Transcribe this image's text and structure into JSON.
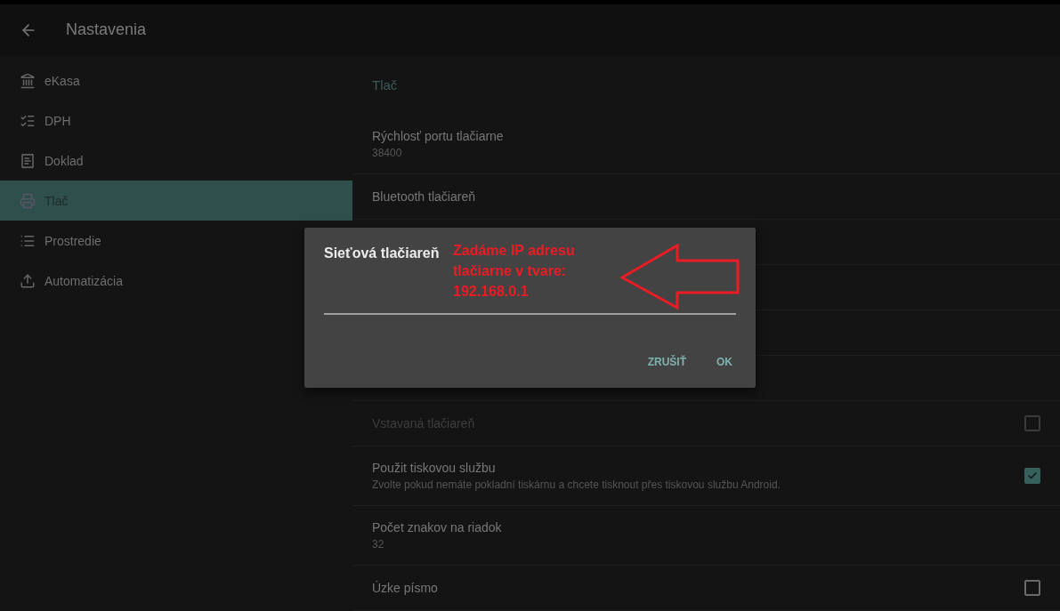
{
  "app_bar": {
    "title": "Nastavenia"
  },
  "sidebar": {
    "items": [
      {
        "label": "eKasa",
        "selected": false
      },
      {
        "label": "DPH",
        "selected": false
      },
      {
        "label": "Doklad",
        "selected": false
      },
      {
        "label": "Tlač",
        "selected": true
      },
      {
        "label": "Prostredie",
        "selected": false
      },
      {
        "label": "Automatizácia",
        "selected": false
      }
    ]
  },
  "section_title": "Tlač",
  "settings_top": [
    {
      "kind": "text",
      "title": "Rýchlosť portu tlačiarne",
      "summary": "38400"
    },
    {
      "kind": "text",
      "title": "Bluetooth tlačiareň"
    }
  ],
  "settings_bottom": [
    {
      "kind": "checkbox",
      "title": "Vstavaná tlačiareň",
      "checked": false,
      "disabled": true
    },
    {
      "kind": "checkbox",
      "title": "Použit tiskovou službu",
      "summary": "Zvolte pokud nemáte pokladní tiskárnu a chcete tisknout přes tiskovou službu Android.",
      "checked": true,
      "disabled": false
    },
    {
      "kind": "text",
      "title": "Počet znakov na riadok",
      "summary": "32"
    },
    {
      "kind": "checkbox",
      "title": "Úzke písmo",
      "checked": false,
      "disabled": false
    }
  ],
  "dialog": {
    "title": "Sieťová tlačiareň",
    "buttons": [
      "ZRUŠIŤ",
      "OK"
    ]
  },
  "annotation": {
    "lines": [
      "Zadáme IP adresu",
      "tlačiarne v tvare:",
      "192.168.0.1"
    ]
  }
}
